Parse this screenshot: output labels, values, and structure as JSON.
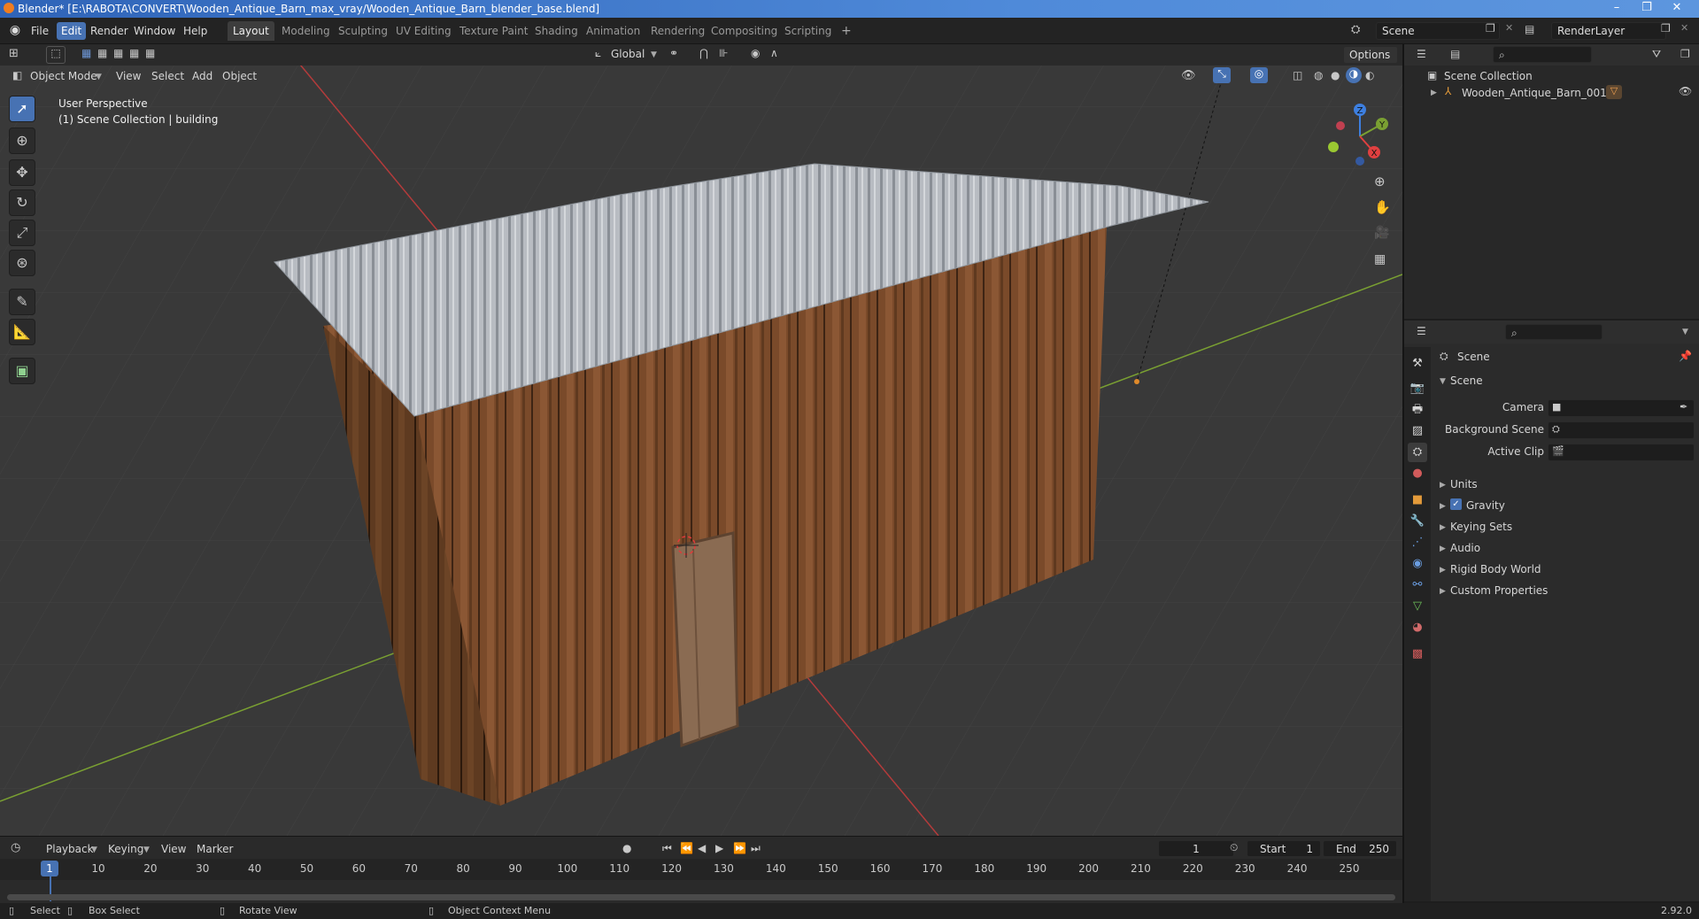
{
  "window": {
    "title": "Blender* [E:\\RABOTA\\CONVERT\\Wooden_Antique_Barn_max_vray/Wooden_Antique_Barn_blender_base.blend]",
    "version": "2.92.0"
  },
  "menu": {
    "file": "File",
    "edit": "Edit",
    "render": "Render",
    "window": "Window",
    "help": "Help"
  },
  "workspaces": [
    "Layout",
    "Modeling",
    "Sculpting",
    "UV Editing",
    "Texture Paint",
    "Shading",
    "Animation",
    "Rendering",
    "Compositing",
    "Scripting"
  ],
  "scene_field": "Scene",
  "render_layer_field": "RenderLayer",
  "viewport": {
    "mode": "Object Mode",
    "menus": [
      "View",
      "Select",
      "Add",
      "Object"
    ],
    "transform_orientation": "Global",
    "options_label": "Options",
    "overlay_line1": "User Perspective",
    "overlay_line2": "(1) Scene Collection | building",
    "gizmo": {
      "x": "X",
      "y": "Y",
      "z": "Z"
    }
  },
  "outliner": {
    "root": "Scene Collection",
    "items": [
      {
        "label": "Wooden_Antique_Barn_001"
      }
    ]
  },
  "properties": {
    "header": "Scene",
    "panel_title": "Scene",
    "camera_label": "Camera",
    "background_scene_label": "Background Scene",
    "active_clip_label": "Active Clip",
    "sections": [
      "Units",
      "Gravity",
      "Keying Sets",
      "Audio",
      "Rigid Body World",
      "Custom Properties"
    ],
    "gravity_checked": true
  },
  "timeline": {
    "menus": [
      "Playback",
      "Keying",
      "View",
      "Marker"
    ],
    "current_frame": "1",
    "start_label": "Start",
    "start": "1",
    "end_label": "End",
    "end": "250",
    "ruler": [
      "1",
      "10",
      "20",
      "30",
      "40",
      "50",
      "60",
      "70",
      "80",
      "90",
      "100",
      "110",
      "120",
      "130",
      "140",
      "150",
      "160",
      "170",
      "180",
      "190",
      "200",
      "210",
      "220",
      "230",
      "240",
      "250"
    ]
  },
  "status": {
    "select": "Select",
    "box_select": "Box Select",
    "rotate_view": "Rotate View",
    "context_menu": "Object Context Menu"
  }
}
